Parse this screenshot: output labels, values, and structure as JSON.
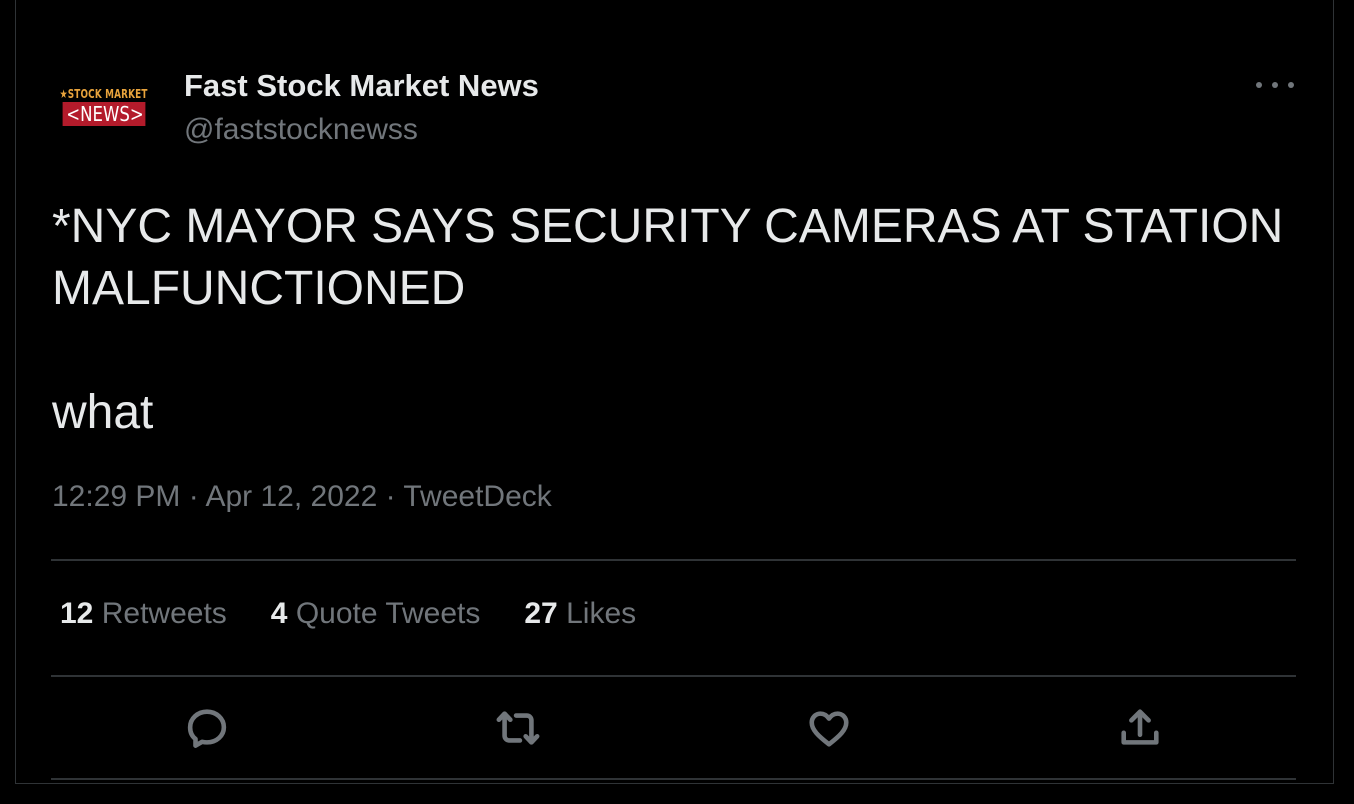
{
  "tweet": {
    "avatar": {
      "line1": "★STOCK MARKET",
      "line2": "<NEWS>"
    },
    "display_name": "Fast Stock Market News",
    "handle": "@faststocknewss",
    "text": "*NYC MAYOR SAYS SECURITY CAMERAS AT STATION MALFUNCTIONED\n\nwhat",
    "time": "12:29 PM",
    "separator": "·",
    "date": "Apr 12, 2022",
    "source": "TweetDeck"
  },
  "stats": {
    "retweets_count": "12",
    "retweets_label": "Retweets",
    "quotes_count": "4",
    "quotes_label": "Quote Tweets",
    "likes_count": "27",
    "likes_label": "Likes"
  },
  "icons": {
    "more": "more-horizontal-icon",
    "reply": "reply-icon",
    "retweet": "retweet-icon",
    "like": "heart-icon",
    "share": "share-icon"
  },
  "colors": {
    "background": "#000000",
    "text": "#e7e9ea",
    "secondary": "#71767b",
    "divider": "#2f3336",
    "avatar_red": "#b31b2b",
    "avatar_orange": "#e8a33c"
  }
}
